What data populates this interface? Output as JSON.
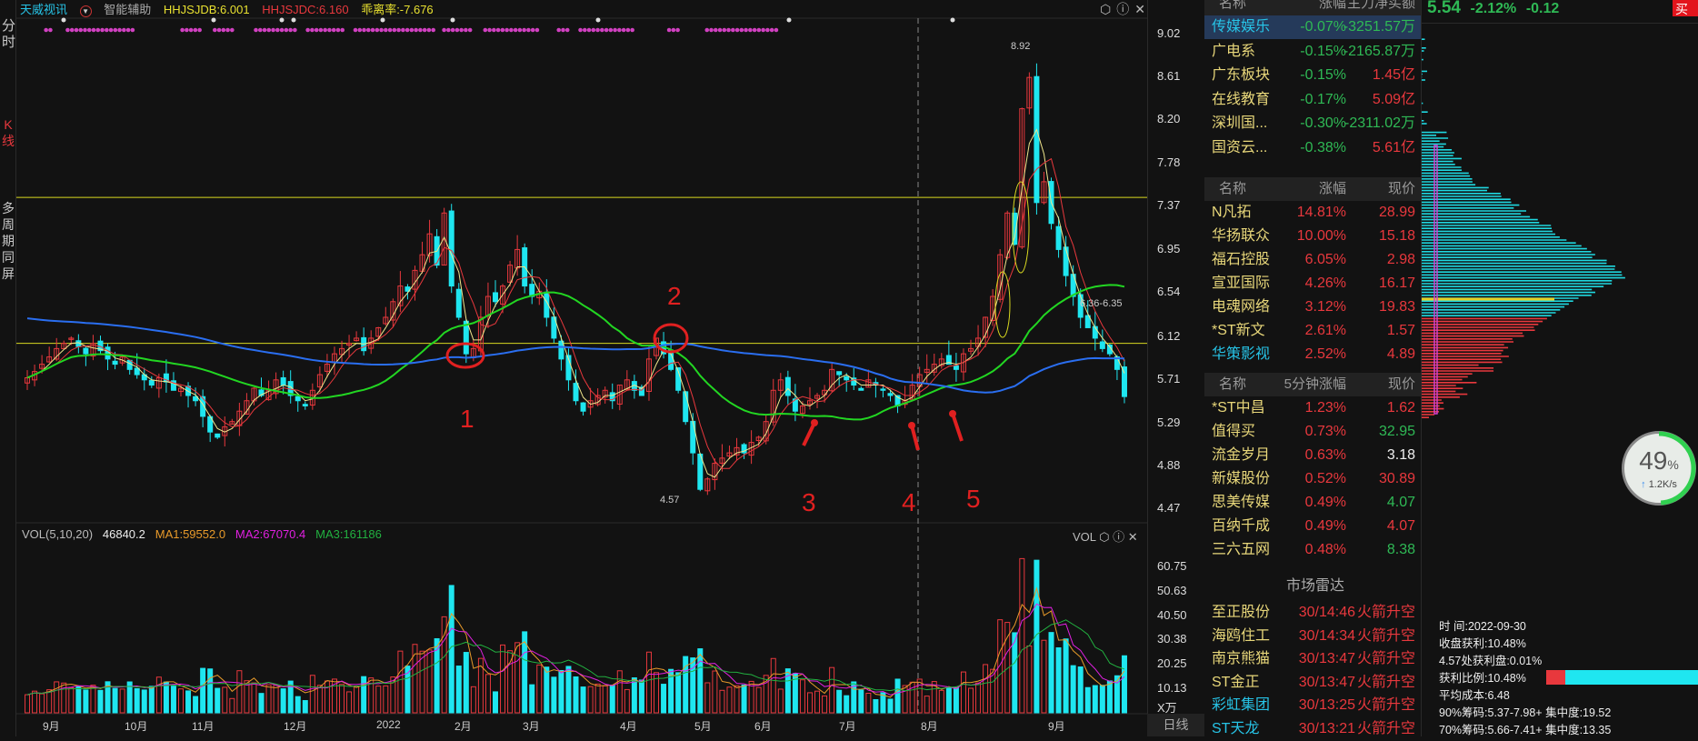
{
  "left_tabs": {
    "fenshi": "分时",
    "kline": "K线",
    "multi": "多周期同屏"
  },
  "header": {
    "stock": "天威视讯",
    "assist": "智能辅助",
    "ind1": "HHJSJDB:6.001",
    "ind2": "HHJSJDC:6.160",
    "ind3": "乖离率:-7.676"
  },
  "price_axis": [
    "9.02",
    "8.61",
    "8.20",
    "7.78",
    "7.37",
    "6.95",
    "6.54",
    "6.12",
    "5.71",
    "5.29",
    "4.88",
    "4.47"
  ],
  "annotations": {
    "high": "8.92",
    "low": "4.57",
    "range": "6.36-6.35",
    "marks": [
      "1",
      "2",
      "3",
      "4",
      "5"
    ]
  },
  "volume": {
    "title": "VOL(5,10,20)",
    "value": "46840.2",
    "ma1": "MA1:59552.0",
    "ma2": "MA2:67070.4",
    "ma3": "MA3:161186",
    "label": "VOL",
    "axis": [
      "60.75",
      "50.63",
      "40.50",
      "30.38",
      "20.25",
      "10.13"
    ],
    "unit": "X万"
  },
  "x_axis": [
    "9月",
    "10月",
    "11月",
    "12月",
    "2022",
    "2月",
    "3月",
    "4月",
    "5月",
    "6月",
    "7月",
    "8月",
    "9月"
  ],
  "period": "日线",
  "chart_data": {
    "type": "candlestick",
    "ylim": [
      4.47,
      9.02
    ],
    "hlines": [
      7.45,
      6.05
    ],
    "closes": [
      5.72,
      5.78,
      5.85,
      5.92,
      6.0,
      6.05,
      6.1,
      6.02,
      5.95,
      6.05,
      5.98,
      5.9,
      5.85,
      5.92,
      5.8,
      5.75,
      5.7,
      5.65,
      5.72,
      5.68,
      5.6,
      5.62,
      5.55,
      5.5,
      5.35,
      5.2,
      5.15,
      5.25,
      5.3,
      5.4,
      5.5,
      5.62,
      5.55,
      5.6,
      5.7,
      5.65,
      5.55,
      5.5,
      5.45,
      5.6,
      5.75,
      5.85,
      5.95,
      6.0,
      6.05,
      6.1,
      5.98,
      6.1,
      6.2,
      6.3,
      6.45,
      6.6,
      6.55,
      6.75,
      6.9,
      7.1,
      6.8,
      7.3,
      6.6,
      6.3,
      5.95,
      6.0,
      6.3,
      6.5,
      6.45,
      6.6,
      6.8,
      6.95,
      6.6,
      6.5,
      6.55,
      6.3,
      6.1,
      5.9,
      5.7,
      5.5,
      5.4,
      5.5,
      5.55,
      5.6,
      5.5,
      5.65,
      5.7,
      5.6,
      5.55,
      5.9,
      6.1,
      5.95,
      5.8,
      5.6,
      5.3,
      5.0,
      4.65,
      4.75,
      4.9,
      4.95,
      5.0,
      5.05,
      5.0,
      5.1,
      5.15,
      5.3,
      5.6,
      5.7,
      5.55,
      5.4,
      5.45,
      5.5,
      5.55,
      5.6,
      5.8,
      5.75,
      5.7,
      5.65,
      5.6,
      5.7,
      5.65,
      5.6,
      5.55,
      5.45,
      5.5,
      5.65,
      5.75,
      5.8,
      5.85,
      5.9,
      5.85,
      5.8,
      5.95,
      6.0,
      6.1,
      6.3,
      6.5,
      6.9,
      7.3,
      7.0,
      8.3,
      8.6,
      7.4,
      7.6,
      7.2,
      6.95,
      6.7,
      6.5,
      6.3,
      6.2,
      6.1,
      6.0,
      5.95,
      5.8,
      5.54
    ]
  },
  "sector_list": {
    "headers": [
      "名称",
      "涨幅",
      "主力净买额"
    ],
    "rows": [
      {
        "name": "传媒娱乐",
        "chg": "-0.07%",
        "flow": "-3251.57万"
      },
      {
        "name": "广电系",
        "chg": "-0.15%",
        "flow": "-2165.87万"
      },
      {
        "name": "广东板块",
        "chg": "-0.15%",
        "flow": "1.45亿"
      },
      {
        "name": "在线教育",
        "chg": "-0.17%",
        "flow": "5.09亿"
      },
      {
        "name": "深圳国...",
        "chg": "-0.30%",
        "flow": "-2311.02万"
      },
      {
        "name": "国资云...",
        "chg": "-0.38%",
        "flow": "5.61亿"
      }
    ]
  },
  "gainers": {
    "headers": [
      "名称",
      "涨幅",
      "现价"
    ],
    "rows": [
      {
        "name": "N凡拓",
        "chg": "14.81%",
        "price": "28.99"
      },
      {
        "name": "华扬联众",
        "chg": "10.00%",
        "price": "15.18"
      },
      {
        "name": "福石控股",
        "chg": "6.05%",
        "price": "2.98"
      },
      {
        "name": "宣亚国际",
        "chg": "4.26%",
        "price": "16.17"
      },
      {
        "name": "电魂网络",
        "chg": "3.12%",
        "price": "19.83"
      },
      {
        "name": "*ST新文",
        "chg": "2.61%",
        "price": "1.57"
      },
      {
        "name": "华策影视",
        "chg": "2.52%",
        "price": "4.89"
      }
    ]
  },
  "five_min": {
    "headers": [
      "名称",
      "5分钟涨幅",
      "现价"
    ],
    "rows": [
      {
        "name": "*ST中昌",
        "chg": "1.23%",
        "price": "1.62"
      },
      {
        "name": "值得买",
        "chg": "0.73%",
        "price": "32.95"
      },
      {
        "name": "流金岁月",
        "chg": "0.63%",
        "price": "3.18"
      },
      {
        "name": "新媒股份",
        "chg": "0.52%",
        "price": "30.89"
      },
      {
        "name": "思美传媒",
        "chg": "0.49%",
        "price": "4.07"
      },
      {
        "name": "百纳千成",
        "chg": "0.49%",
        "price": "4.07"
      },
      {
        "name": "三六五网",
        "chg": "0.48%",
        "price": "8.38"
      }
    ]
  },
  "radar": {
    "title": "市场雷达",
    "rows": [
      {
        "name": "至正股份",
        "time": "30/14:46",
        "event": "火箭升空"
      },
      {
        "name": "海鸥住工",
        "time": "30/14:34",
        "event": "火箭升空"
      },
      {
        "name": "南京熊猫",
        "time": "30/13:47",
        "event": "火箭升空"
      },
      {
        "name": "ST金正",
        "time": "30/13:47",
        "event": "火箭升空"
      },
      {
        "name": "彩虹集团",
        "time": "30/13:25",
        "event": "火箭升空"
      },
      {
        "name": "ST天龙",
        "time": "30/13:21",
        "event": "火箭升空"
      }
    ]
  },
  "quote": {
    "price": "5.54",
    "pct": "-2.12%",
    "chg": "-0.12",
    "buy": "买入"
  },
  "widget": {
    "percent": "49",
    "unit": "%",
    "speed": "1.2K/s",
    "fill": 0.49
  },
  "chip": {
    "time": "时        间:2022-09-30",
    "profit": "收盘获利:10.48%",
    "at": "4.57处获利盘:0.01%",
    "ratio": "获利比例:10.48%",
    "ratio_value": 0.1048,
    "avg": "平均成本:6.48",
    "c90": "90%筹码:5.37-7.98+ 集中度:19.52",
    "c70": "70%筹码:5.66-7.41+ 集中度:13.35"
  },
  "colors": {
    "up": "#e8383d",
    "down": "#1fe6f0",
    "ma5": "#f0e68c",
    "ma10": "#e8383d",
    "ma60": "#22d622",
    "ma120": "#2a6ef0",
    "bg": "#121212"
  }
}
